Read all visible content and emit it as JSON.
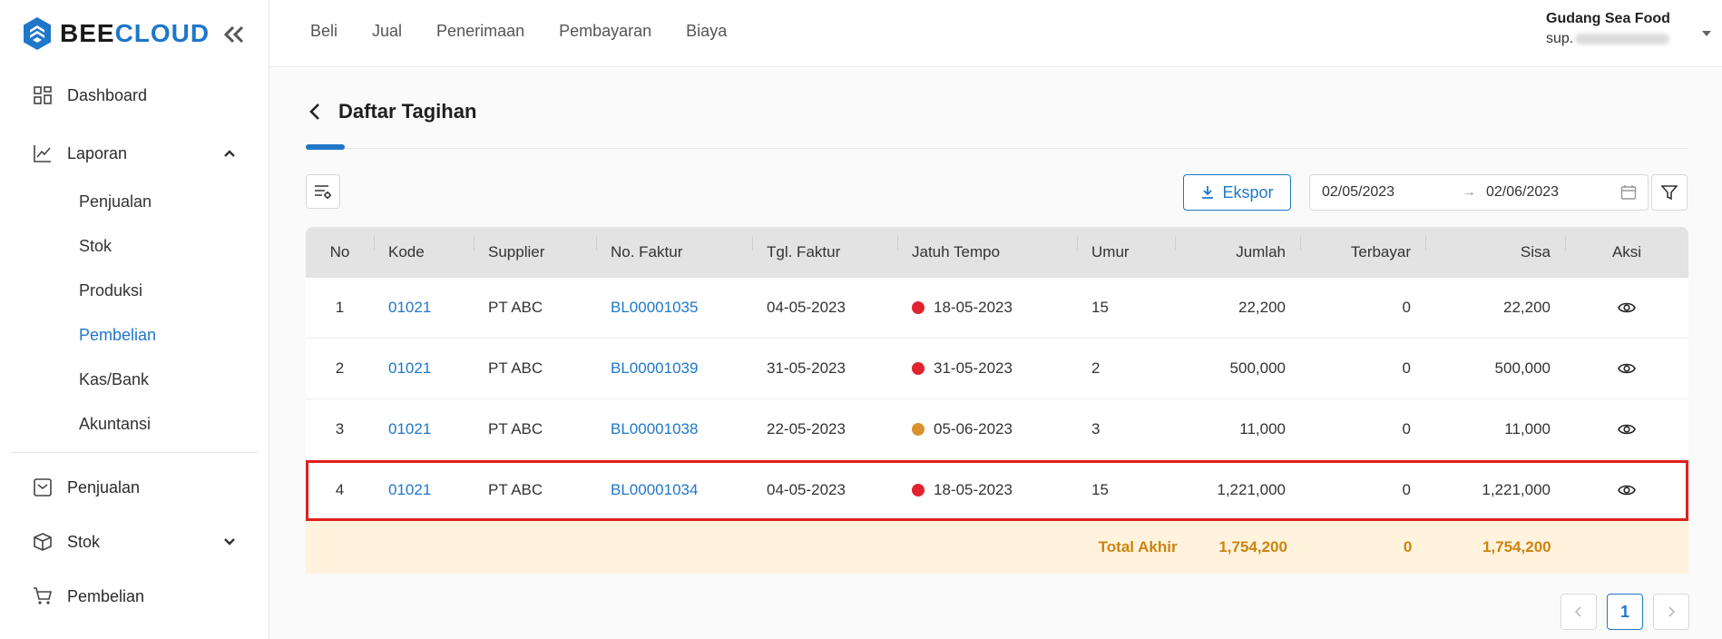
{
  "brand": {
    "name_part1": "BEE",
    "name_part2": "CLOUD",
    "accent": "#1f77c9"
  },
  "sidebar": {
    "items": [
      {
        "label": "Dashboard",
        "icon": "dashboard-icon"
      },
      {
        "label": "Laporan",
        "icon": "chart-line-icon",
        "expanded": true,
        "children": [
          "Penjualan",
          "Stok",
          "Produksi",
          "Pembelian",
          "Kas/Bank",
          "Akuntansi"
        ],
        "active_child": "Pembelian"
      },
      {
        "label": "Penjualan",
        "icon": "inbox-icon"
      },
      {
        "label": "Stok",
        "icon": "box-icon",
        "expanded": false
      },
      {
        "label": "Pembelian",
        "icon": "cart-icon"
      }
    ]
  },
  "topnav": {
    "items": [
      "Beli",
      "Jual",
      "Penerimaan",
      "Pembayaran",
      "Biaya"
    ]
  },
  "user": {
    "name": "Gudang Sea Food",
    "email_prefix": "sup."
  },
  "page": {
    "title": "Daftar Tagihan"
  },
  "toolbar": {
    "export_label": "Ekspor",
    "date_from": "02/05/2023",
    "date_to": "02/06/2023",
    "arrow": "→"
  },
  "table": {
    "headers": {
      "no": "No",
      "kode": "Kode",
      "supplier": "Supplier",
      "faktur": "No. Faktur",
      "tgl": "Tgl. Faktur",
      "jatuh_tempo": "Jatuh Tempo",
      "umur": "Umur",
      "jumlah": "Jumlah",
      "terbayar": "Terbayar",
      "sisa": "Sisa",
      "aksi": "Aksi"
    },
    "rows": [
      {
        "no": "1",
        "kode": "01021",
        "supplier": "PT ABC",
        "faktur": "BL00001035",
        "tgl": "04-05-2023",
        "jatuh_tempo": "18-05-2023",
        "status_color": "#e0242f",
        "umur": "15",
        "jumlah": "22,200",
        "terbayar": "0",
        "sisa": "22,200"
      },
      {
        "no": "2",
        "kode": "01021",
        "supplier": "PT ABC",
        "faktur": "BL00001039",
        "tgl": "31-05-2023",
        "jatuh_tempo": "31-05-2023",
        "status_color": "#e0242f",
        "umur": "2",
        "jumlah": "500,000",
        "terbayar": "0",
        "sisa": "500,000"
      },
      {
        "no": "3",
        "kode": "01021",
        "supplier": "PT ABC",
        "faktur": "BL00001038",
        "tgl": "22-05-2023",
        "jatuh_tempo": "05-06-2023",
        "status_color": "#d9922e",
        "umur": "3",
        "jumlah": "11,000",
        "terbayar": "0",
        "sisa": "11,000"
      },
      {
        "no": "4",
        "kode": "01021",
        "supplier": "PT ABC",
        "faktur": "BL00001034",
        "tgl": "04-05-2023",
        "jatuh_tempo": "18-05-2023",
        "status_color": "#e0242f",
        "umur": "15",
        "jumlah": "1,221,000",
        "terbayar": "0",
        "sisa": "1,221,000"
      }
    ],
    "total": {
      "label": "Total Akhir",
      "jumlah": "1,754,200",
      "terbayar": "0",
      "sisa": "1,754,200"
    }
  },
  "pagination": {
    "current": "1"
  }
}
